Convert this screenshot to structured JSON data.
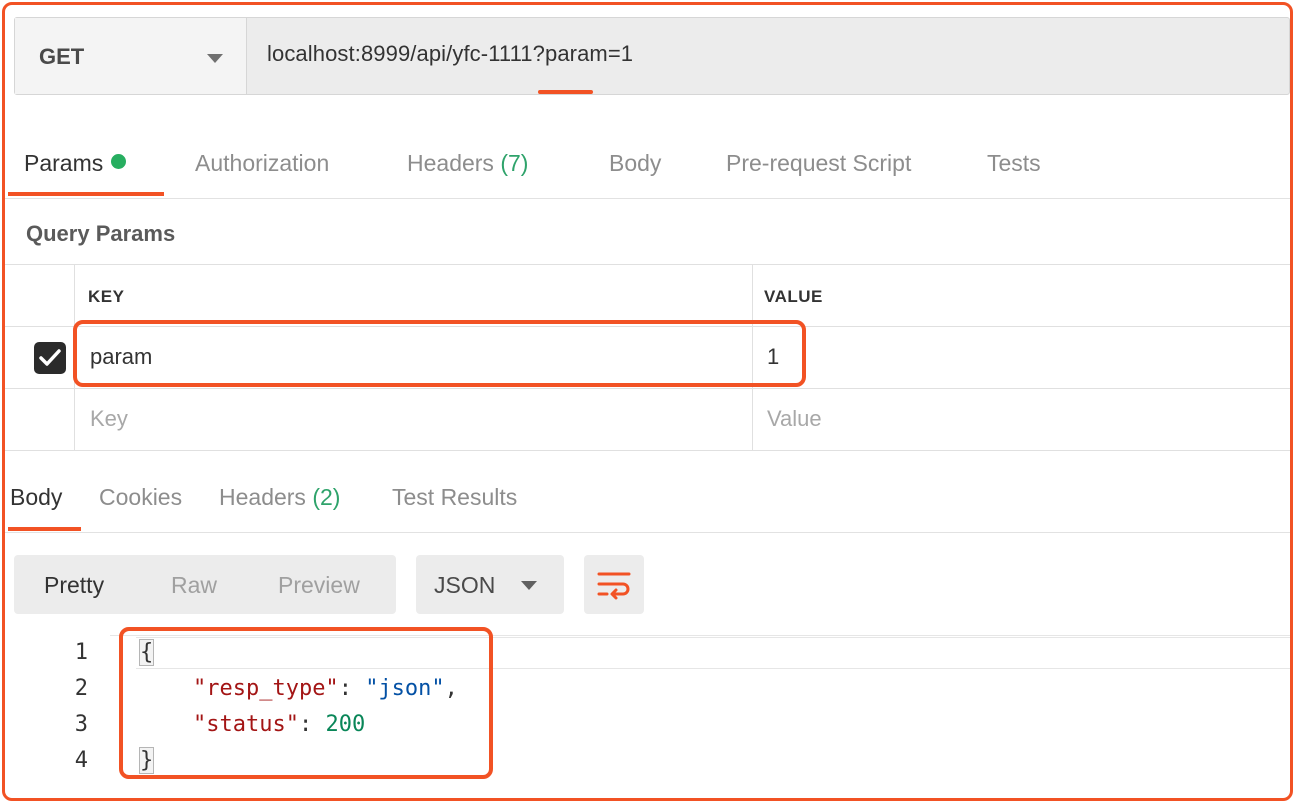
{
  "request": {
    "method": "GET",
    "url": "localhost:8999/api/yfc-1111?param=1"
  },
  "request_tabs": [
    {
      "label": "Params",
      "active": true,
      "has_dot": true
    },
    {
      "label": "Authorization"
    },
    {
      "label": "Headers",
      "count": "(7)"
    },
    {
      "label": "Body"
    },
    {
      "label": "Pre-request Script"
    },
    {
      "label": "Tests"
    }
  ],
  "query_params": {
    "title": "Query Params",
    "headers": {
      "key": "KEY",
      "value": "VALUE"
    },
    "rows": [
      {
        "checked": true,
        "key": "param",
        "value": "1"
      }
    ],
    "new_row": {
      "key_placeholder": "Key",
      "value_placeholder": "Value"
    }
  },
  "response_tabs": [
    {
      "label": "Body",
      "active": true
    },
    {
      "label": "Cookies"
    },
    {
      "label": "Headers",
      "count": "(2)"
    },
    {
      "label": "Test Results"
    }
  ],
  "response_toolbar": {
    "view_modes": [
      "Pretty",
      "Raw",
      "Preview"
    ],
    "active_view_mode": "Pretty",
    "format": "JSON"
  },
  "response_body": {
    "line_numbers": [
      "1",
      "2",
      "3",
      "4"
    ],
    "open_brace": "{",
    "close_brace": "}",
    "fields": [
      {
        "key": "\"resp_type\"",
        "value": "\"json\"",
        "value_type": "string",
        "trailing": ","
      },
      {
        "key": "\"status\"",
        "value": "200",
        "value_type": "number",
        "trailing": ""
      }
    ],
    "colon": ": "
  },
  "colors": {
    "accent": "#f25224",
    "success_green": "#27ae60",
    "json_key": "#a31515",
    "json_string": "#0451a5",
    "json_number": "#098658"
  },
  "icons": {
    "method_dropdown": "chevron-down-icon",
    "format_dropdown": "chevron-down-icon",
    "wrap": "wrap-lines-icon",
    "checkbox": "checkmark-icon"
  }
}
